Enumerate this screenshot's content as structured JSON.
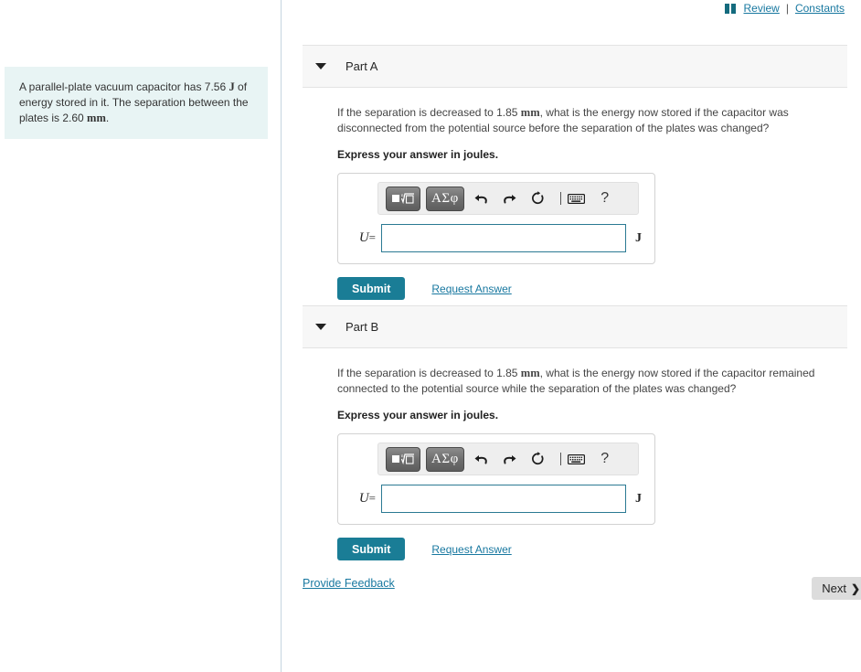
{
  "top_links": {
    "book_icon": "book-icon",
    "review_label": "Review",
    "separator": "|",
    "constants_label": "Constants"
  },
  "problem": {
    "text_before_J": "A parallel-plate vacuum capacitor has 7.56 ",
    "unit_J": "J",
    "text_middle": " of energy stored in it. The separation between the plates is 2.60 ",
    "unit_mm": "mm",
    "text_end": "."
  },
  "parts": [
    {
      "title": "Part A",
      "caret_icon": "chevron-down-icon",
      "question_lead": "If the separation is decreased to 1.85 ",
      "question_unit": "mm",
      "question_tail": ", what is the energy now stored if the capacitor was disconnected from the potential source before the separation of the plates was changed?",
      "instruction": "Express your answer in joules.",
      "toolbar": {
        "math_template_label": "√",
        "greek_label": "ΑΣφ",
        "undo_icon": "undo-icon",
        "redo_icon": "redo-icon",
        "reset_icon": "reset-icon",
        "keyboard_icon": "keyboard-icon",
        "help_label": "?"
      },
      "variable": "U",
      "equals": "=",
      "value": "",
      "placeholder": "",
      "unit": "J",
      "submit_label": "Submit",
      "request_answer_label": "Request Answer"
    },
    {
      "title": "Part B",
      "caret_icon": "chevron-down-icon",
      "question_lead": "If the separation is decreased to 1.85 ",
      "question_unit": "mm",
      "question_tail": ", what is the energy now stored if the capacitor remained connected to the potential source while the separation of the plates was changed?",
      "instruction": "Express your answer in joules.",
      "toolbar": {
        "math_template_label": "√",
        "greek_label": "ΑΣφ",
        "undo_icon": "undo-icon",
        "redo_icon": "redo-icon",
        "reset_icon": "reset-icon",
        "keyboard_icon": "keyboard-icon",
        "help_label": "?"
      },
      "variable": "U",
      "equals": "=",
      "value": "",
      "placeholder": "",
      "unit": "J",
      "submit_label": "Submit",
      "request_answer_label": "Request Answer"
    }
  ],
  "footer": {
    "feedback_label": "Provide Feedback",
    "next_label": "Next",
    "next_chevron": "❯"
  },
  "colors": {
    "link": "#1878a0",
    "submit_bg": "#1a7d96",
    "problem_bg": "#e8f4f4",
    "input_border": "#2b7a93",
    "part_header_bg": "#f7f7f7",
    "next_bg": "#dcdcdc"
  }
}
